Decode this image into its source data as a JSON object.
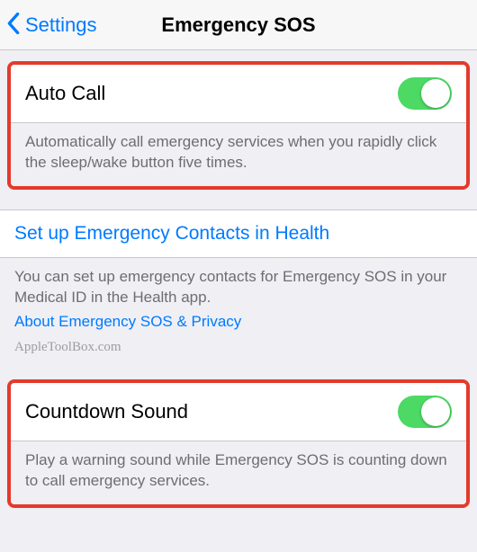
{
  "nav": {
    "back_label": "Settings",
    "title": "Emergency SOS"
  },
  "auto_call": {
    "label": "Auto Call",
    "enabled": true,
    "description": "Automatically call emergency services when you rapidly click the sleep/wake button five times."
  },
  "contacts": {
    "link_label": "Set up Emergency Contacts in Health",
    "description": "You can set up emergency contacts for Emergency SOS in your Medical ID in the Health app.",
    "privacy_link": "About Emergency SOS & Privacy"
  },
  "watermark": "AppleToolBox.com",
  "countdown": {
    "label": "Countdown Sound",
    "enabled": true,
    "description": "Play a warning sound while Emergency SOS is counting down to call emergency services."
  }
}
